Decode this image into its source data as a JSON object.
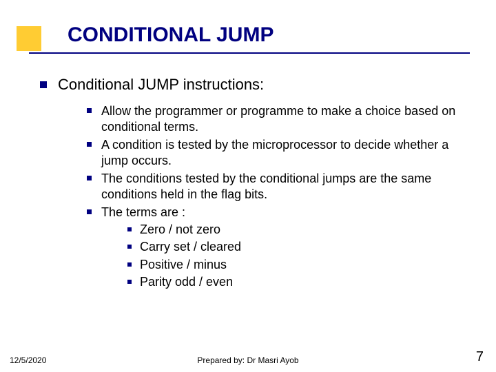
{
  "title": "CONDITIONAL JUMP",
  "main": {
    "heading": "Conditional JUMP instructions:",
    "items": [
      "Allow the programmer or programme to make a choice based on conditional terms.",
      "A condition is tested by the microprocessor to decide whether a jump occurs.",
      "The conditions tested by the conditional jumps are the same conditions held in the flag bits.",
      "The terms are :"
    ],
    "terms": [
      "Zero / not zero",
      "Carry set / cleared",
      "Positive / minus",
      "Parity odd / even"
    ]
  },
  "footer": {
    "date": "12/5/2020",
    "center": "Prepared by: Dr Masri Ayob",
    "page": "7"
  }
}
